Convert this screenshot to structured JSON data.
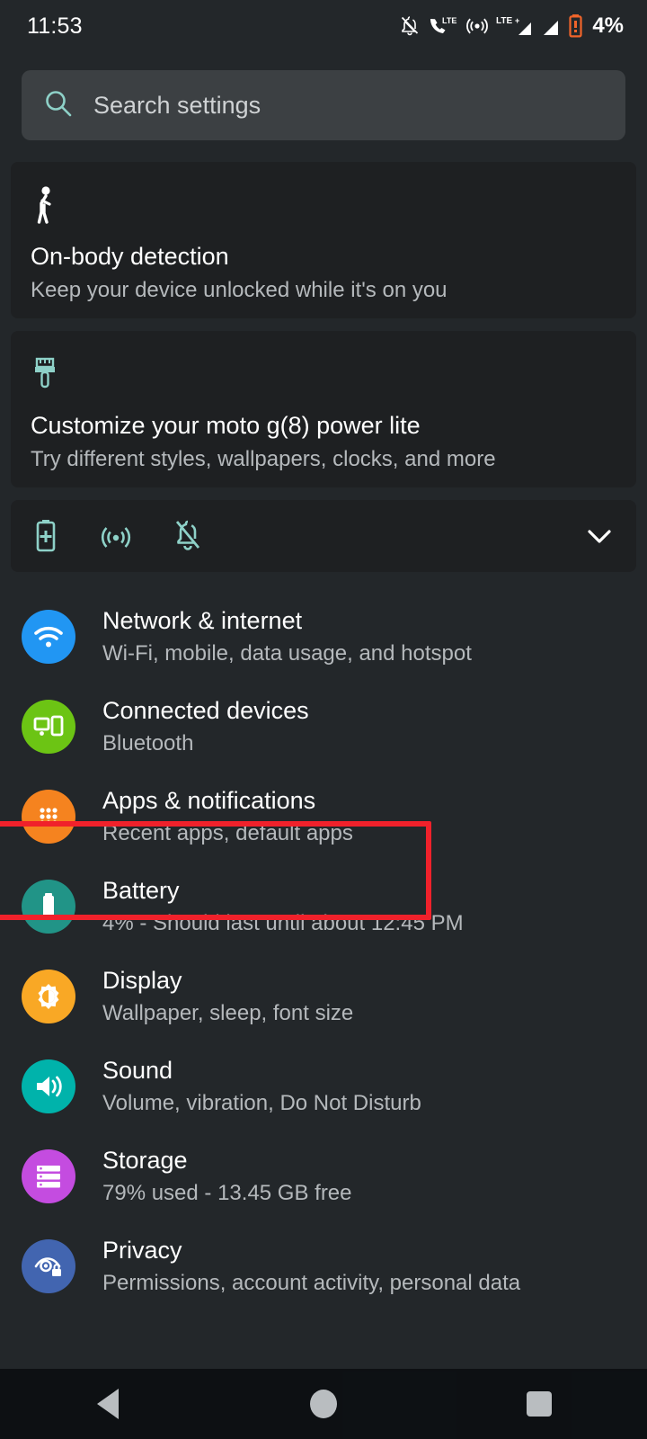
{
  "status_bar": {
    "time": "11:53",
    "battery_percent": "4%",
    "icons": [
      "bell-off-icon",
      "call-lte-icon",
      "hotspot-icon",
      "lte-signal-icon",
      "signal-bars-icon",
      "battery-low-icon"
    ],
    "battery_color": "#f0642a"
  },
  "search": {
    "placeholder": "Search settings",
    "icon": "search-icon",
    "icon_color": "#8ed1c8"
  },
  "suggestions": [
    {
      "icon": "walking-person-icon",
      "icon_color": "#ffffff",
      "title": "On-body detection",
      "subtitle": "Keep your device unlocked while it's on you"
    },
    {
      "icon": "paintbrush-icon",
      "icon_color": "#8ed1c8",
      "title": "Customize your moto g(8) power lite",
      "subtitle": "Try different styles, wallpapers, clocks, and more"
    }
  ],
  "toggle_strip": {
    "icons": [
      "battery-saver-icon",
      "hotspot-icon",
      "bell-off-icon"
    ],
    "icon_color": "#8ed1c8",
    "expand_icon": "chevron-down-icon"
  },
  "settings_rows": [
    {
      "name": "network-internet",
      "title": "Network & internet",
      "subtitle": "Wi-Fi, mobile, data usage, and hotspot",
      "icon": "wifi-icon",
      "bg": "#2196f3"
    },
    {
      "name": "connected-devices",
      "title": "Connected devices",
      "subtitle": "Bluetooth",
      "icon": "devices-icon",
      "bg": "#6cc414"
    },
    {
      "name": "apps-notifications",
      "title": "Apps & notifications",
      "subtitle": "Recent apps, default apps",
      "icon": "apps-grid-icon",
      "bg": "#f5831f",
      "highlighted": true
    },
    {
      "name": "battery",
      "title": "Battery",
      "subtitle": "4% - Should last until about 12:45 PM",
      "icon": "battery-icon",
      "bg": "#219487"
    },
    {
      "name": "display",
      "title": "Display",
      "subtitle": "Wallpaper, sleep, font size",
      "icon": "brightness-icon",
      "bg": "#f9a825"
    },
    {
      "name": "sound",
      "title": "Sound",
      "subtitle": "Volume, vibration, Do Not Disturb",
      "icon": "speaker-icon",
      "bg": "#00b3ab"
    },
    {
      "name": "storage",
      "title": "Storage",
      "subtitle": "79% used - 13.45 GB free",
      "icon": "storage-icon",
      "bg": "#c44ce0"
    },
    {
      "name": "privacy",
      "title": "Privacy",
      "subtitle": "Permissions, account activity, personal data",
      "icon": "privacy-eye-lock-icon",
      "bg": "#4265b0"
    }
  ],
  "highlight": {
    "color": "#f0212b",
    "target": "apps-notifications"
  },
  "nav_bar": {
    "back": "back-triangle-icon",
    "home": "home-circle-icon",
    "recents": "recents-square-icon"
  }
}
